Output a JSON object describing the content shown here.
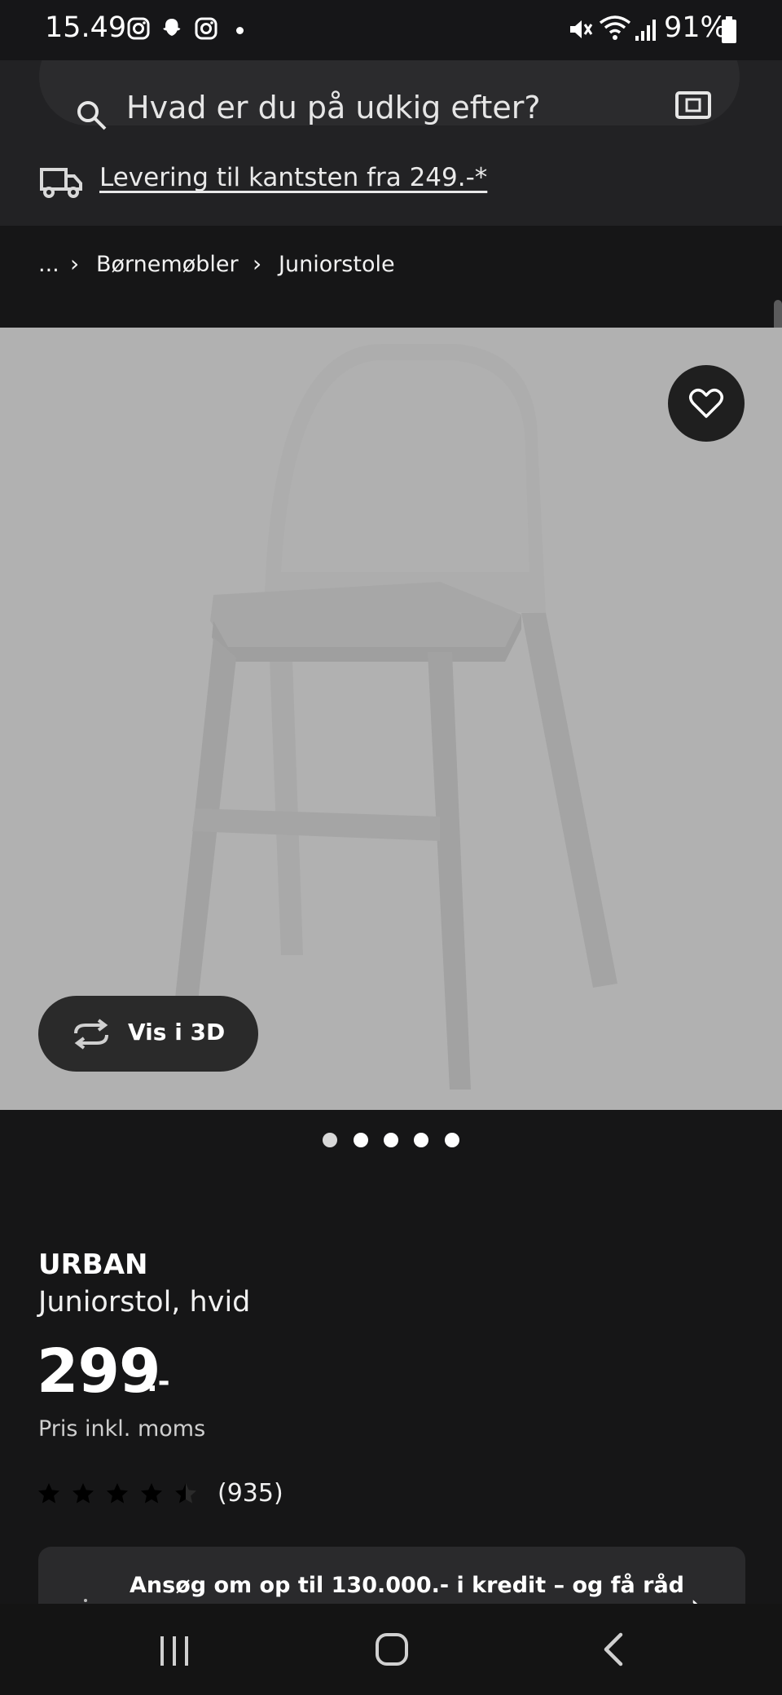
{
  "status_bar": {
    "time": "15.49",
    "battery": "91%"
  },
  "search": {
    "placeholder": "Hvad er du på udkig efter?"
  },
  "delivery": {
    "text": "Levering til kantsten fra 249.-*"
  },
  "breadcrumb": {
    "ellipsis": "...",
    "items": [
      "Børnemøbler",
      "Juniorstole"
    ]
  },
  "gallery": {
    "button_3d": "Vis i 3D",
    "dot_count": 5,
    "active_dot": 0
  },
  "product": {
    "brand": "URBAN",
    "description": "Juniorstol, hvid",
    "price_integer": "299",
    "price_suffix": ".-",
    "vat_note": "Pris inkl. moms",
    "rating_stars": 4.5,
    "review_count": "(935)"
  },
  "credit": {
    "text": "Ansøg om op til 130.000.- i kredit – og få råd"
  },
  "colors": {
    "background": "#161617",
    "image_background": "#b1b1b1",
    "button_dark": "#2a2a2a"
  }
}
